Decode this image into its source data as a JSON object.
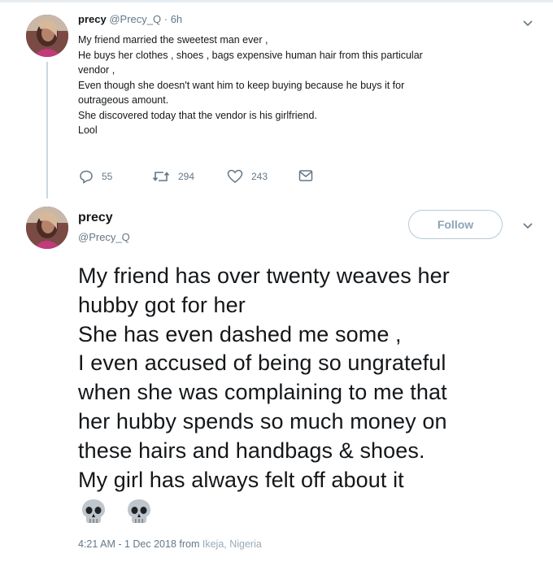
{
  "tweet1": {
    "name": "precy",
    "handle": "@Precy_Q",
    "dot": "·",
    "time": "6h",
    "lines": [
      "My friend married the sweetest man ever ,",
      "He buys her clothes , shoes ,  bags expensive human hair from this particular",
      "vendor ,",
      "Even though she doesn't want him to keep buying because he buys it for",
      "outrageous amount.",
      "She discovered today that the vendor is his girlfriend.",
      "Lool"
    ],
    "actions": {
      "replies": "55",
      "retweets": "294",
      "likes": "243"
    }
  },
  "tweet2": {
    "name": "precy",
    "handle": "@Precy_Q",
    "follow_label": "Follow",
    "lines": [
      "My friend has over twenty weaves her",
      "hubby got for her",
      "She has even dashed me some ,",
      "I even accused of being so ungrateful",
      "when she was complaining to me that",
      "her hubby spends so much money on",
      "these hairs and handbags & shoes.",
      "My girl has always felt off about it"
    ],
    "emojis": [
      "skull-emoji",
      "skull-emoji"
    ],
    "timestamp": "4:21 AM - 1 Dec 2018 from",
    "location": "Ikeja, Nigeria"
  },
  "icons": {
    "reply": "reply-icon",
    "retweet": "retweet-icon",
    "like": "heart-icon",
    "dm": "envelope-icon",
    "more": "chevron-down-icon"
  },
  "colors": {
    "text": "#14171a",
    "secondary": "#657786",
    "follow": "#8aa4b8",
    "thread_line": "#ccd6dd"
  }
}
